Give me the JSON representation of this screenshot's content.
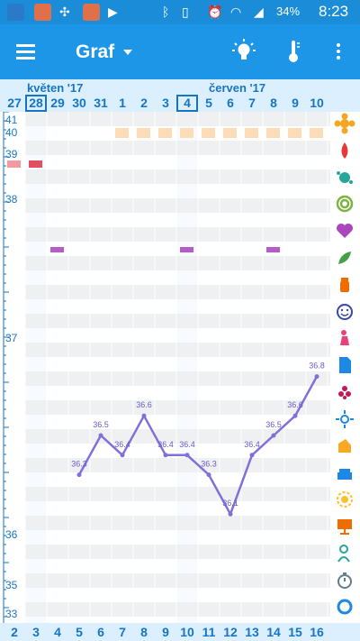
{
  "status_bar": {
    "battery": "34%",
    "time": "8:23",
    "app_icons": [
      "p-app-icon",
      "orange-app-icon",
      "pinwheel-icon",
      "orange-app-icon-2",
      "play-store-icon"
    ],
    "system_icons": [
      "bluetooth-icon",
      "vibrate-icon",
      "alarm-icon",
      "wifi-icon",
      "signal-icon"
    ]
  },
  "app_bar": {
    "title": "Graf",
    "actions": [
      "lightbulb-icon",
      "thermometer-icon",
      "overflow-menu-icon"
    ]
  },
  "months": [
    "květen '17",
    "červen '17"
  ],
  "days": [
    "27",
    "28",
    "29",
    "30",
    "31",
    "1",
    "2",
    "3",
    "4",
    "5",
    "6",
    "7",
    "8",
    "9",
    "10"
  ],
  "bottom_days": [
    "2",
    "3",
    "4",
    "5",
    "6",
    "7",
    "8",
    "9",
    "10",
    "11",
    "12",
    "13",
    "14",
    "15",
    "16"
  ],
  "colors": {
    "accent": "#1e96e8",
    "line": "#8070d8",
    "orange_marker": "#fddcb8",
    "pink_marker": "#f07a7a",
    "purple_marker": "#b45cc8"
  },
  "sidebar_icons": [
    {
      "name": "flower-icon",
      "color": "#f5a623"
    },
    {
      "name": "drop-icon",
      "color": "#e53935"
    },
    {
      "name": "virus-icon",
      "color": "#26a69a"
    },
    {
      "name": "rings-icon",
      "color": "#7cb342"
    },
    {
      "name": "heart-icon",
      "color": "#ab47bc"
    },
    {
      "name": "leaf-icon",
      "color": "#43a047"
    },
    {
      "name": "pill-bottle-icon",
      "color": "#ef6c00"
    },
    {
      "name": "smiley-icon",
      "color": "#3949ab"
    },
    {
      "name": "pink-figure-icon",
      "color": "#ec407a"
    },
    {
      "name": "document-icon",
      "color": "#1e88e5"
    },
    {
      "name": "berry-icon",
      "color": "#c2185b"
    },
    {
      "name": "spark-icon",
      "color": "#1e88e5"
    },
    {
      "name": "bandage-icon",
      "color": "#f9a825"
    },
    {
      "name": "cake-icon",
      "color": "#1e88e5"
    },
    {
      "name": "gear-flower-icon",
      "color": "#fbc02d"
    },
    {
      "name": "presentation-icon",
      "color": "#ef6c00"
    },
    {
      "name": "doctor-icon",
      "color": "#26a69a"
    },
    {
      "name": "timer-icon",
      "color": "#607d8b"
    },
    {
      "name": "cycle-icon",
      "color": "#1e88e5"
    }
  ],
  "chart_data": {
    "type": "line",
    "x": [
      "27",
      "28",
      "29",
      "30",
      "31",
      "1",
      "2",
      "3",
      "4",
      "5",
      "6",
      "7",
      "8",
      "9",
      "10"
    ],
    "series": [
      {
        "values": [
          null,
          null,
          null,
          36.3,
          36.5,
          36.4,
          36.6,
          36.4,
          36.4,
          36.3,
          36.1,
          36.4,
          36.5,
          36.6,
          36.8
        ],
        "labels": [
          "",
          "",
          "",
          "36.3",
          "36.5",
          "36.4",
          "36.6",
          "36.4",
          "36.4",
          "36.3",
          "36.1",
          "36.4",
          "36.5",
          "36.6",
          "36.8"
        ]
      }
    ],
    "y_ticks": [
      "41",
      "40",
      "39",
      "38",
      "37",
      "36",
      "35",
      "33"
    ],
    "markers": {
      "orange_row": [
        "1",
        "2",
        "3",
        "4",
        "5",
        "6",
        "7",
        "8",
        "9",
        "10"
      ],
      "pink_row": [
        "27",
        "28"
      ],
      "purple_row": [
        "29",
        "4",
        "8"
      ]
    },
    "grid": true
  }
}
